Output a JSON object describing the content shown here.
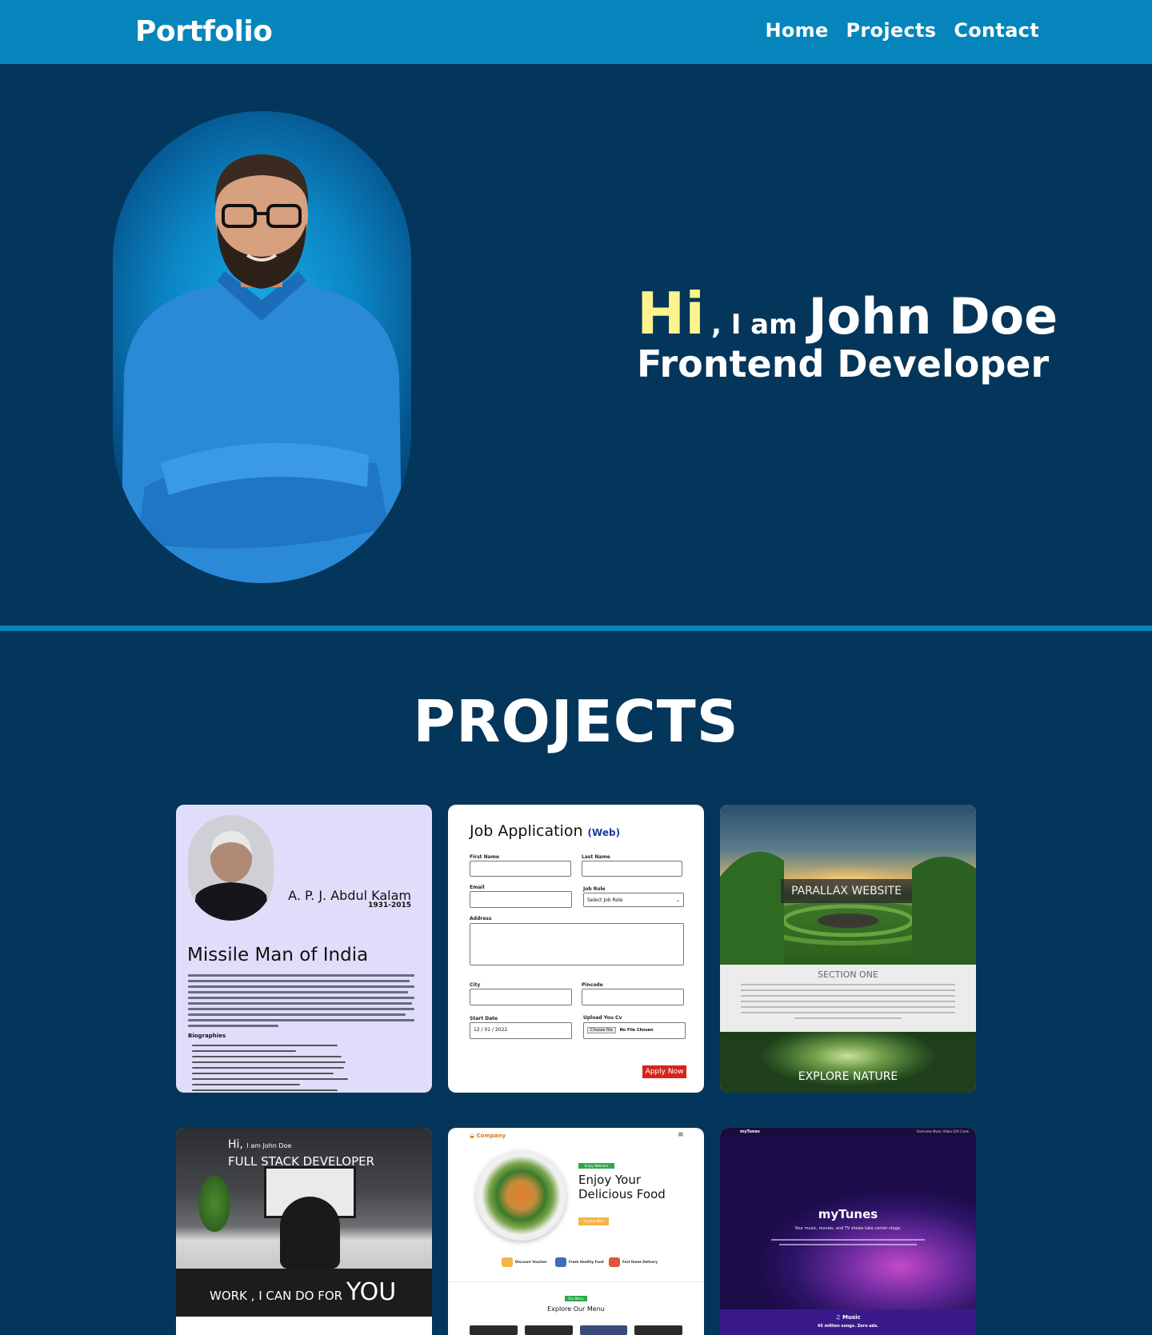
{
  "nav": {
    "logo": "Portfolio",
    "links": [
      "Home",
      "Projects",
      "Contact"
    ]
  },
  "hero": {
    "greeting": "Hi",
    "intro": ", I am",
    "name": "John Doe",
    "role": "Frontend Developer"
  },
  "projects": {
    "title": "PROJECTS",
    "kalam": {
      "name": "A. P. J. Abdul Kalam",
      "years": "1931-2015",
      "title": "Missile Man of India",
      "bio_heading": "Biographies"
    },
    "job": {
      "title": "Job Application",
      "tag": "(Web)",
      "labels": {
        "first_name": "First Name",
        "last_name": "Last Name",
        "email": "Email",
        "job_role": "Job Role",
        "address": "Address",
        "city": "City",
        "pincode": "Pincode",
        "start_date": "Start Date",
        "upload_cv": "Upload You Cv"
      },
      "job_role_value": "Select Job Role",
      "start_date_value": "12 / 01 / 2022",
      "choose_file": "Choose file",
      "no_file": "No File Chosen",
      "apply": "Apply Now"
    },
    "parallax": {
      "label": "PARALLAX WEBSITE",
      "section": "SECTION ONE",
      "explore": "EXPLORE NATURE"
    },
    "fullstack": {
      "hi": "Hi,",
      "iam": "I am John Doe",
      "role": "FULL STACK DEVELOPER",
      "work": "WORK , I CAN DO FOR",
      "you": "YOU"
    },
    "food": {
      "logo": "Company",
      "menu_icon": "≡",
      "tag": "Enjoy Wellness",
      "title_line1": "Enjoy Your",
      "title_line2": "Delicious Food",
      "button": "Explore Now",
      "features": [
        "Discount Voucher",
        "Fresh Healthy Food",
        "Fast Home Delivery"
      ],
      "menu_tag": "Our Menu",
      "menu_title": "Explore Our Menu"
    },
    "mytunes": {
      "logo": "myTunes",
      "nav": "Overview   Music   Video   Gift Cards",
      "title": "myTunes",
      "subtitle": "Your music, movies, and TV shows take center stage.",
      "music": "♫ Music",
      "tagline": "45 million songs. Zero ads."
    }
  }
}
